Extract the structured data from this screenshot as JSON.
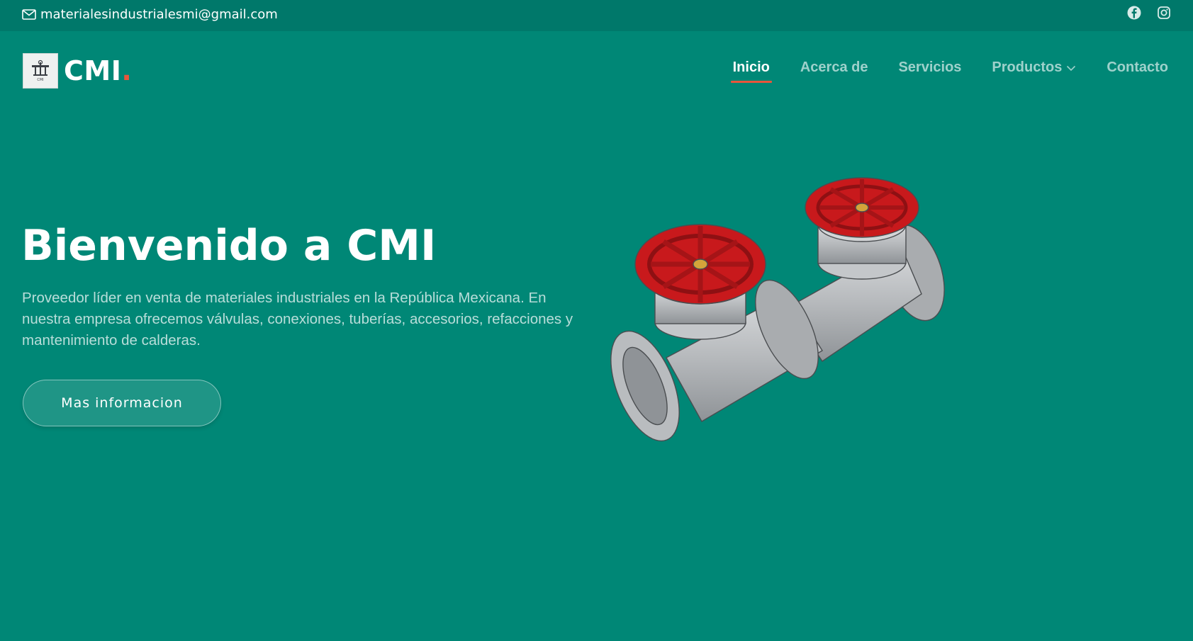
{
  "topbar": {
    "email": "materialesindustrialesmi@gmail.com",
    "mail_icon": "envelope-icon",
    "social_icons": [
      "facebook-icon",
      "instagram-icon"
    ]
  },
  "logo": {
    "text": "CMI",
    "dot": ".",
    "image_caption": "CMI"
  },
  "nav": {
    "items": [
      {
        "label": "Inicio",
        "active": true
      },
      {
        "label": "Acerca de",
        "active": false
      },
      {
        "label": "Servicios",
        "active": false
      },
      {
        "label": "Productos",
        "active": false,
        "dropdown": true
      },
      {
        "label": "Contacto",
        "active": false
      }
    ]
  },
  "hero": {
    "title": "Bienvenido a CMI",
    "description": "Proveedor líder en venta de materiales industriales en la República Mexicana. En nuestra empresa ofrecemos válvulas, conexiones, tuberías, accesorios, refacciones y mantenimiento de calderas.",
    "button_label": "Mas informacion",
    "image": "gate-valves-illustration"
  },
  "colors": {
    "background": "#008776",
    "topbar": "#00786a",
    "accent": "#e9553b",
    "valve_handwheel": "#c8191c",
    "valve_body": "#b9bcbf"
  }
}
